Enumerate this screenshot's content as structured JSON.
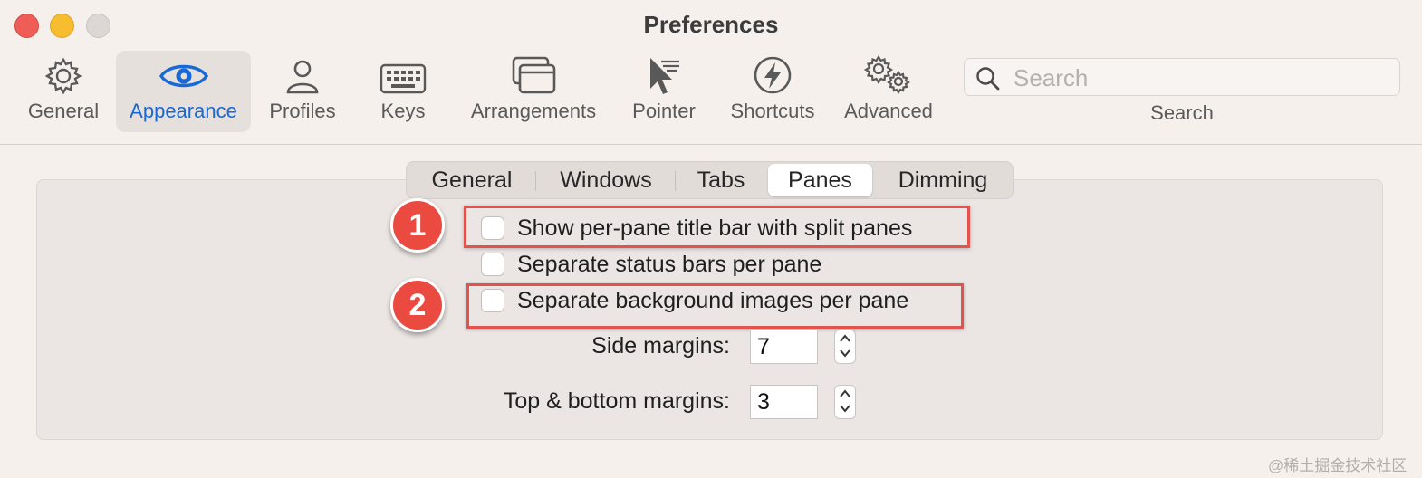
{
  "window": {
    "title": "Preferences"
  },
  "toolbar": {
    "items": [
      {
        "label": "General",
        "icon": "gear-icon"
      },
      {
        "label": "Appearance",
        "icon": "eye-icon",
        "selected": true
      },
      {
        "label": "Profiles",
        "icon": "person-icon"
      },
      {
        "label": "Keys",
        "icon": "keyboard-icon"
      },
      {
        "label": "Arrangements",
        "icon": "windows-icon"
      },
      {
        "label": "Pointer",
        "icon": "pointer-icon"
      },
      {
        "label": "Shortcuts",
        "icon": "lightning-icon"
      },
      {
        "label": "Advanced",
        "icon": "gears-icon"
      }
    ],
    "search": {
      "placeholder": "Search",
      "value": "",
      "caption": "Search"
    }
  },
  "tabs": [
    {
      "label": "General"
    },
    {
      "label": "Windows"
    },
    {
      "label": "Tabs"
    },
    {
      "label": "Panes",
      "selected": true
    },
    {
      "label": "Dimming"
    }
  ],
  "panes": {
    "options": [
      {
        "label": "Show per-pane title bar with split panes",
        "checked": false
      },
      {
        "label": "Separate status bars per pane",
        "checked": false
      },
      {
        "label": "Separate background images per pane",
        "checked": false
      }
    ],
    "side_margins": {
      "label": "Side margins:",
      "value": "7"
    },
    "top_bottom_margins": {
      "label": "Top & bottom margins:",
      "value": "3"
    }
  },
  "annotations": {
    "badge1": "1",
    "badge2": "2",
    "color": "#e2534d"
  },
  "watermark": "@稀土掘金技术社区",
  "colors": {
    "accent": "#1868d6",
    "close": "#ee5e57",
    "minimize": "#f5bd2f",
    "zoom": "#dcd7d4"
  }
}
